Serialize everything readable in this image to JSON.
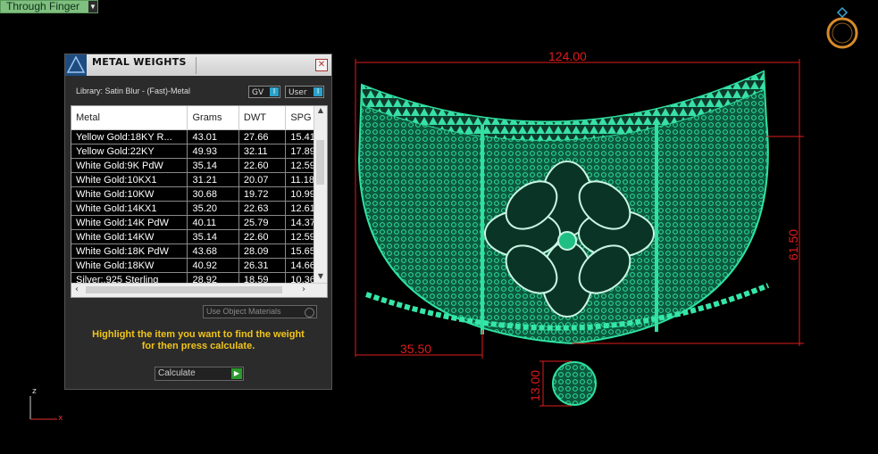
{
  "top_button": {
    "label": "Through Finger"
  },
  "panel": {
    "title": "METAL WEIGHTS",
    "library": "Library: Satin Blur - (Fast)-Metal",
    "toggle_gv": "GV",
    "toggle_user": "User",
    "table": {
      "headers": [
        "Metal",
        "Grams",
        "DWT",
        "SPG"
      ],
      "rows": [
        [
          "Yellow Gold:18KY R...",
          "43.01",
          "27.66",
          "15.41"
        ],
        [
          "Yellow Gold:22KY",
          "49.93",
          "32.11",
          "17.89"
        ],
        [
          "White Gold:9K PdW",
          "35.14",
          "22.60",
          "12.59"
        ],
        [
          "White Gold:10KX1",
          "31.21",
          "20.07",
          "11.18"
        ],
        [
          "White Gold:10KW",
          "30.68",
          "19.72",
          "10.99"
        ],
        [
          "White Gold:14KX1",
          "35.20",
          "22.63",
          "12.61"
        ],
        [
          "White Gold:14K PdW",
          "40.11",
          "25.79",
          "14.37"
        ],
        [
          "White Gold:14KW",
          "35.14",
          "22.60",
          "12.59"
        ],
        [
          "White Gold:18K PdW",
          "43.68",
          "28.09",
          "15.65"
        ],
        [
          "White Gold:18KW",
          "40.92",
          "26.31",
          "14.66"
        ],
        [
          "Silver:.925 Sterling",
          "28.92",
          "18.59",
          "10.36"
        ]
      ]
    },
    "use_object_materials": "Use Object Materials",
    "hint_line1": "Highlight the item you want to find the weight",
    "hint_line2": "for then press calculate.",
    "calculate": "Calculate"
  },
  "dimensions": {
    "width": "124.00",
    "height": "61.50",
    "offset": "35.50",
    "small": "13.00"
  },
  "axis": {
    "z": "z",
    "x": "x"
  },
  "colors": {
    "dimension": "#e01b1b",
    "model": "#1fbf83",
    "hint": "#f0c419"
  }
}
